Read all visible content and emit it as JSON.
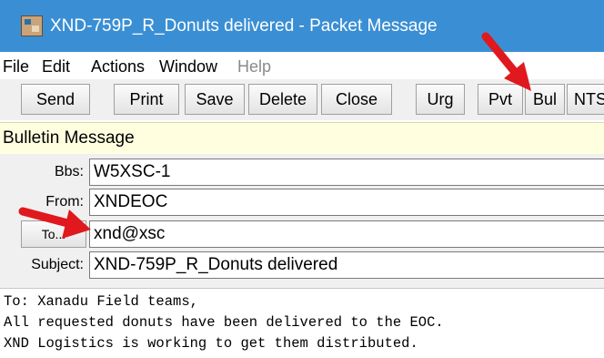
{
  "window": {
    "title": "XND-759P_R_Donuts delivered - Packet Message"
  },
  "menu": {
    "items": [
      "File",
      "Edit",
      "Actions",
      "Window",
      "Help"
    ]
  },
  "toolbar": {
    "send": "Send",
    "print": "Print",
    "save": "Save",
    "delete": "Delete",
    "close": "Close",
    "urg": "Urg",
    "pvt": "Pvt",
    "bul": "Bul",
    "nts": "NTS"
  },
  "banner": {
    "text": "Bulletin Message"
  },
  "form": {
    "bbs_label": "Bbs:",
    "bbs_value": "W5XSC-1",
    "from_label": "From:",
    "from_value": "XNDEOC",
    "to_button": "To...",
    "to_value": "xnd@xsc",
    "subject_label": "Subject:",
    "subject_value": "XND-759P_R_Donuts delivered"
  },
  "message": {
    "lines": [
      "To: Xanadu Field teams,",
      "All requested donuts have been delivered to the EOC.",
      "XND Logistics is working to get them distributed."
    ]
  },
  "colors": {
    "titlebar": "#3a8fd4",
    "banner": "#ffffe0",
    "arrow": "#e0191e"
  }
}
